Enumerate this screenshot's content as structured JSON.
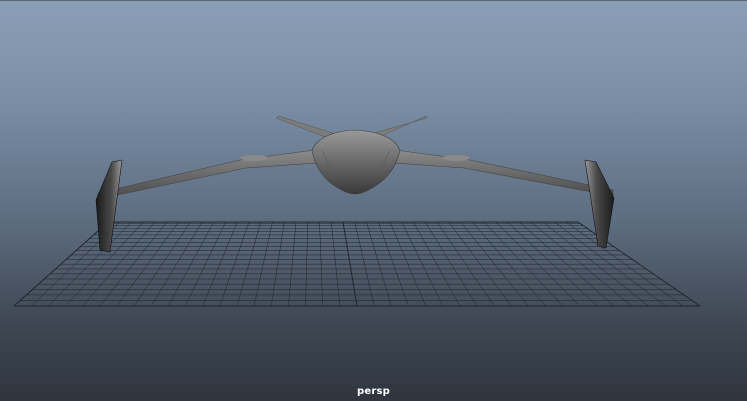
{
  "viewport": {
    "camera_label": "persp",
    "background_colors": {
      "top": "#8a9fb7",
      "bottom": "#2f353d"
    },
    "grid_color": "#1e2228",
    "model_color": "#6a6a6a",
    "model_name_icon": "aircraft-model-icon",
    "grid_icon": "ground-grid-icon"
  }
}
